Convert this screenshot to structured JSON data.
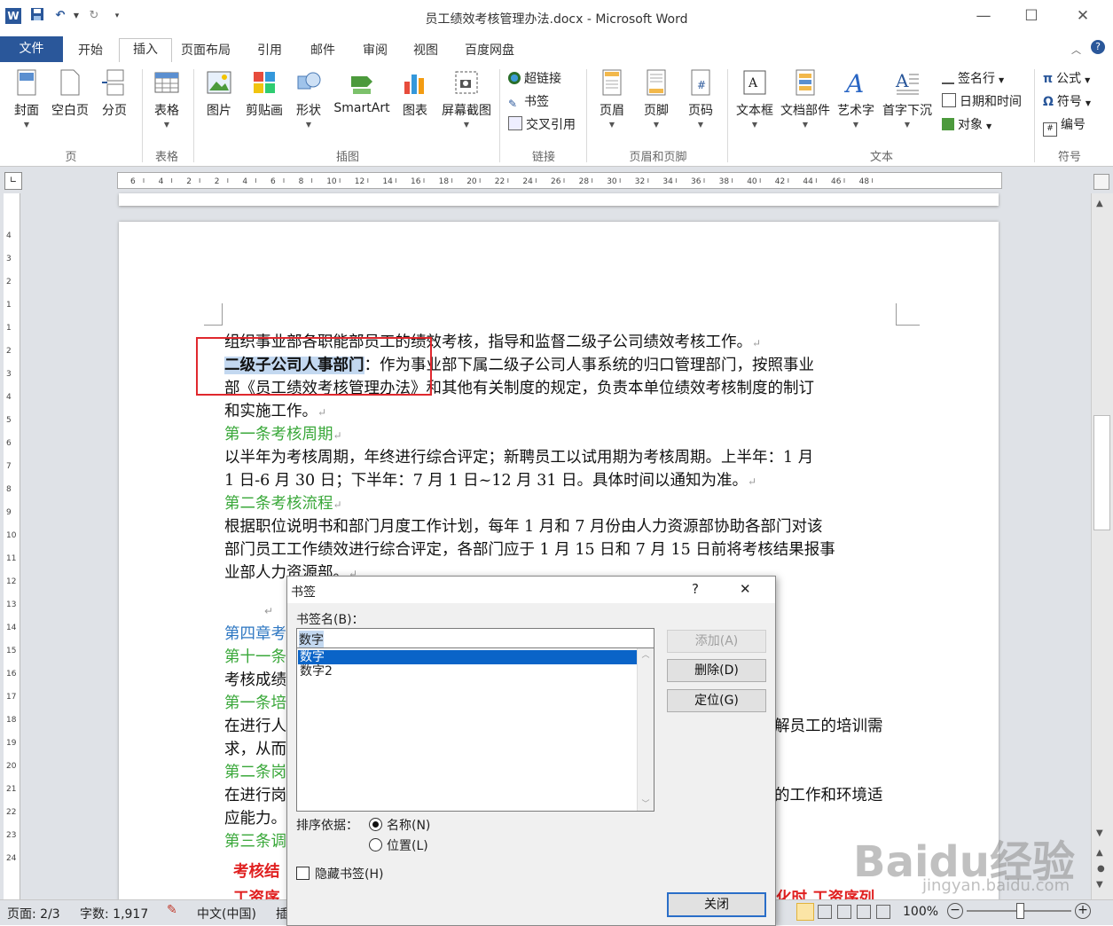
{
  "window": {
    "title": "员工绩效考核管理办法.docx - Microsoft Word"
  },
  "ribbon_tabs": [
    "文件",
    "开始",
    "插入",
    "页面布局",
    "引用",
    "邮件",
    "审阅",
    "视图",
    "百度网盘"
  ],
  "ribbon": {
    "page_group": {
      "label": "页",
      "items": [
        "封面",
        "空白页",
        "分页"
      ]
    },
    "table_group": {
      "label": "表格",
      "items": [
        "表格"
      ]
    },
    "illustrations_group": {
      "label": "插图",
      "items": [
        "图片",
        "剪贴画",
        "形状",
        "SmartArt",
        "图表",
        "屏幕截图"
      ]
    },
    "links_group": {
      "label": "链接",
      "items": [
        "超链接",
        "书签",
        "交叉引用"
      ]
    },
    "header_footer_group": {
      "label": "页眉和页脚",
      "items": [
        "页眉",
        "页脚",
        "页码"
      ]
    },
    "text_group": {
      "label": "文本",
      "items": [
        "文本框",
        "文档部件",
        "艺术字",
        "首字下沉"
      ],
      "small": [
        "签名行",
        "日期和时间",
        "对象"
      ]
    },
    "symbols_group": {
      "label": "符号",
      "items": [
        "公式",
        "符号",
        "编号"
      ]
    }
  },
  "ruler": {
    "labels": [
      "6",
      "4",
      "2",
      "2",
      "4",
      "6",
      "8",
      "10",
      "12",
      "14",
      "16",
      "18",
      "20",
      "22",
      "24",
      "26",
      "28",
      "30",
      "32",
      "34",
      "36",
      "38",
      "40",
      "42",
      "44",
      "46",
      "48"
    ]
  },
  "vruler": {
    "labels": [
      "4",
      "3",
      "2",
      "1",
      "1",
      "2",
      "3",
      "4",
      "5",
      "6",
      "7",
      "8",
      "9",
      "10",
      "11",
      "12",
      "13",
      "14",
      "15",
      "16",
      "17",
      "18",
      "19",
      "20",
      "21",
      "22",
      "23",
      "24"
    ]
  },
  "document": {
    "line1": "组织事业部各职能部员工的绩效考核，指导和监督二级子公司绩效考核工作。",
    "line2_bold": "二级子公司人事部门",
    "line2_rest": "：作为事业部下属二级子公司人事系统的归口管理部门，按照事业",
    "line3": "部《员工绩效考核管理办法》和其他有关制度的规定，负责本单位绩效考核制度的制订",
    "line4": "和实施工作。",
    "heading1": "第一条考核周期",
    "line5": "以半年为考核周期，年终进行综合评定；新聘员工以试用期为考核周期。上半年：1 月",
    "line6": "1 日-6 月 30 日；下半年：7 月 1 日~12 月 31 日。具体时间以通知为准。",
    "heading2": "第二条考核流程",
    "line7": "根据职位说明书和部门月度工作计划，每年 1 月和 7 月份由人力资源部协助各部门对该",
    "line8": "部门员工工作绩效进行综合评定，各部门应于 1 月 15 日和 7 月 15 日前将考核结果报事",
    "line9": "业部人力资源部。",
    "frag_chapter4": "第四章考",
    "frag_art11": "第十一条",
    "frag_result": "考核成绩",
    "frag_art1": "第一条培",
    "frag_train": "在进行人",
    "frag_train_right": "解员工的培训需",
    "frag_need": "求，从而",
    "frag_art2": "第二条岗",
    "frag_post": "在进行岗",
    "frag_post_right": "的工作和环境适",
    "frag_adapt": "应能力。",
    "frag_art3": "第三条调",
    "frag_red1": "考核结",
    "frag_red2": "工资序",
    "frag_red2_right": "化时,工资序列"
  },
  "dialog": {
    "title": "书签",
    "help": "?",
    "close_x": "✕",
    "name_label": "书签名(B)：",
    "name_value": "数字",
    "list": [
      "数字",
      "数字2"
    ],
    "add": "添加(A)",
    "delete": "删除(D)",
    "goto": "定位(G)",
    "sort_label": "排序依据：",
    "sort_name": "名称(N)",
    "sort_location": "位置(L)",
    "hidden": "隐藏书签(H)",
    "close": "关闭"
  },
  "status": {
    "page": "页面: 2/3",
    "words": "字数: 1,917",
    "lang": "中文(中国)",
    "insert": "插",
    "zoom": "100%"
  },
  "watermark": {
    "main": "Baidu经验",
    "sub": "jingyan.baidu.com"
  },
  "colors": {
    "accent": "#2a579a",
    "heading_green": "#3aa83a",
    "heading_blue": "#2e77c2",
    "highlight_red": "#e0282e"
  }
}
